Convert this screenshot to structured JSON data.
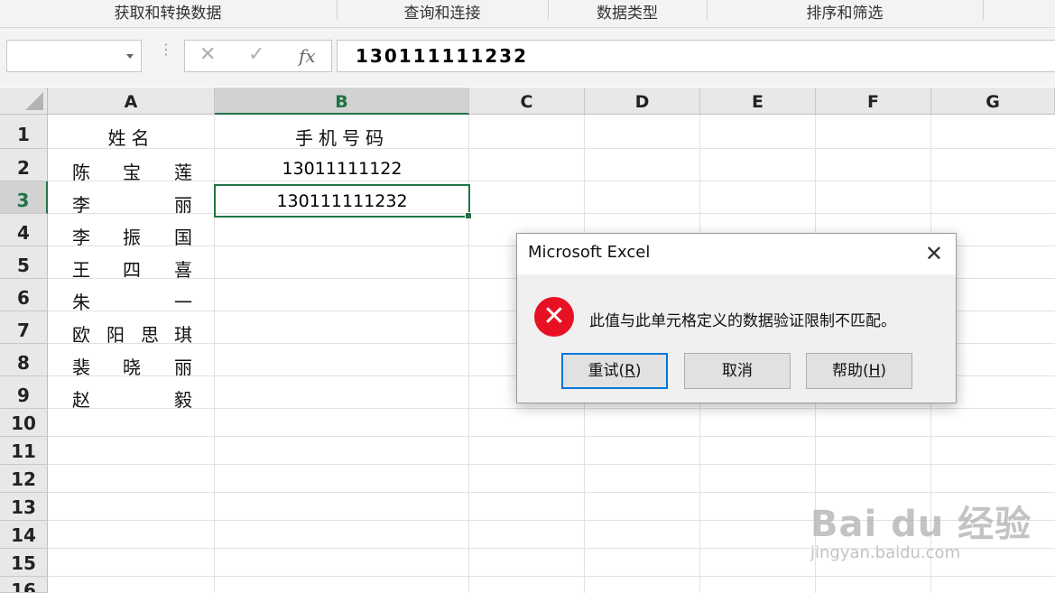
{
  "ribbon": {
    "groups": [
      "获取和转换数据",
      "查询和连接",
      "数据类型",
      "排序和筛选"
    ]
  },
  "formula_bar": {
    "name_box": "",
    "cancel_icon": "✕",
    "enter_icon": "✓",
    "fx_label": "fx",
    "value": "130111111232"
  },
  "columns": [
    "A",
    "B",
    "C",
    "D",
    "E",
    "F",
    "G"
  ],
  "rows": [
    "1",
    "2",
    "3",
    "4",
    "5",
    "6",
    "7",
    "8",
    "9",
    "10",
    "11",
    "12",
    "13",
    "14",
    "15",
    "16"
  ],
  "sheet": {
    "A1": "姓名",
    "B1": "手机号码",
    "names": [
      [
        "陈",
        "宝",
        "莲"
      ],
      [
        "李",
        "",
        "丽"
      ],
      [
        "李",
        "振",
        "国"
      ],
      [
        "王",
        "四",
        "喜"
      ],
      [
        "朱",
        "",
        "一"
      ],
      [
        "欧",
        "阳",
        "思",
        "琪"
      ],
      [
        "裴",
        "晓",
        "丽"
      ],
      [
        "赵",
        "",
        "毅"
      ]
    ],
    "B2": "13011111122",
    "B3": "130111111232"
  },
  "dialog": {
    "title": "Microsoft Excel",
    "close_icon": "✕",
    "error_icon": "✕",
    "message": "此值与此单元格定义的数据验证限制不匹配。",
    "buttons": {
      "retry": "重试(",
      "retry_key": "R",
      "cancel": "取消",
      "help": "帮助(",
      "help_key": "H",
      "close_paren": ")"
    }
  },
  "watermark": {
    "brand": "Bai du 经验",
    "url": "jingyan.baidu.com"
  }
}
